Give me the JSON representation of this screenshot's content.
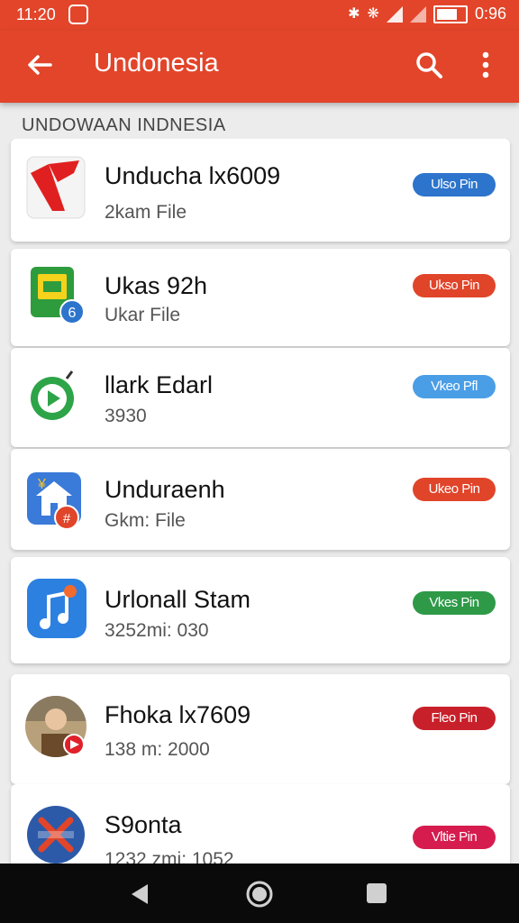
{
  "status": {
    "time": "11:20",
    "right_time": "0:96",
    "icons": [
      "notification-icon",
      "bluetooth-icon",
      "vibrate-icon",
      "signal-icon",
      "signal-icon",
      "battery-icon"
    ]
  },
  "appbar": {
    "title": "Undonesia",
    "icons": [
      "back-arrow-icon",
      "search-icon",
      "more-vert-icon"
    ]
  },
  "section": {
    "header": "UNDOWAAN INDNESIA"
  },
  "items": [
    {
      "name": "Unducha lx6009",
      "sub": "2kam File",
      "button": "Ulso Pin",
      "button_color": "#2c74cc",
      "icon": "adobe-acrobat-icon"
    },
    {
      "name": "Ukas 92h",
      "sub": "Ukar File",
      "button": "Ukso Pin",
      "button_color": "#e0452a",
      "icon": "notes-app-icon"
    },
    {
      "name": "llark Edarl",
      "sub": "3930",
      "button": "Vkeo Pfl",
      "button_color": "#4a9ee6",
      "icon": "play-circle-icon"
    },
    {
      "name": "Unduraenh",
      "sub": "Gkm: File",
      "button": "Ukeo Pin",
      "button_color": "#e0452a",
      "icon": "home-store-icon"
    },
    {
      "name": "Urlonall Stam",
      "sub": "3252mi: 030",
      "button": "Vkes Pin",
      "button_color": "#2e9a48",
      "icon": "music-note-icon"
    },
    {
      "name": "Fhoka lx7609",
      "sub": "138 m: 2000",
      "button": "Fleo Pin",
      "button_color": "#c8202a",
      "icon": "avatar-photo-icon"
    },
    {
      "name": "S9onta",
      "sub": "1232 zmi: 1052",
      "button": "Vltie Pin",
      "button_color": "#d61c4e",
      "icon": "x-mark-app-icon"
    }
  ],
  "navbar": {
    "icons": [
      "nav-back-icon",
      "nav-home-icon",
      "nav-recents-icon"
    ]
  }
}
